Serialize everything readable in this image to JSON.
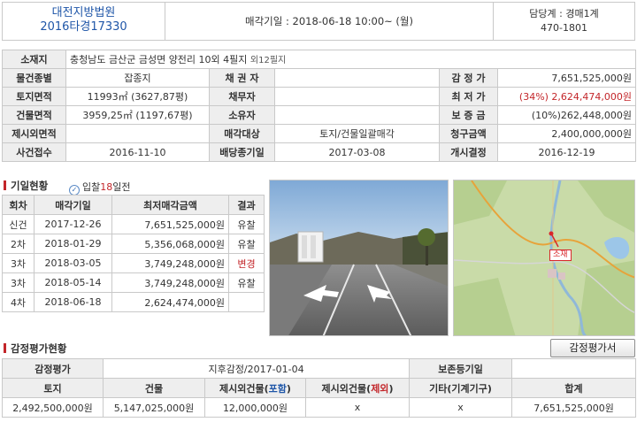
{
  "header": {
    "court": "대전지방법원",
    "case_no": "2016타경17330",
    "sale_date": "매각기일 : 2018-06-18   10:00~ (월)",
    "dept_label": "담당계 : 경매1계",
    "dept_phone": "470-1801"
  },
  "info": {
    "location_label": "소재지",
    "location_value": "충청남도 금산군 금성면 양전리 10외 4필지",
    "location_extra": "외12필지",
    "type_label": "물건종별",
    "type_value": "잡종지",
    "creditor_label": "채 권 자",
    "creditor_value": "",
    "appraisal_label": "감 정 가",
    "appraisal_value": "7,651,525,000원",
    "land_area_label": "토지면적",
    "land_area_value": "11993㎡ (3627,87평)",
    "debtor_label": "채무자",
    "debtor_value": "",
    "min_price_label": "최 저 가",
    "min_price_value": "(34%) 2,624,474,000원",
    "building_area_label": "건물면적",
    "building_area_value": "3959,25㎡ (1197,67평)",
    "owner_label": "소유자",
    "owner_value": "",
    "deposit_label": "보 증 금",
    "deposit_value": "(10%)262,448,000원",
    "excluded_area_label": "제시외면적",
    "excluded_area_value": "",
    "sale_target_label": "매각대상",
    "sale_target_value": "토지/건물일괄매각",
    "claim_label": "청구금액",
    "claim_value": "2,400,000,000원",
    "received_label": "사건접수",
    "received_value": "2016-11-10",
    "dividend_label": "배당종기일",
    "dividend_value": "2017-03-08",
    "start_label": "개시결정",
    "start_value": "2016-12-19"
  },
  "history": {
    "title": "기일현황",
    "notice_prefix": "입찰",
    "notice_days": "18",
    "notice_suffix": "일전",
    "headers": [
      "회차",
      "매각기일",
      "최저매각금액",
      "결과"
    ],
    "rows": [
      {
        "round": "신건",
        "date": "2017-12-26",
        "price": "7,651,525,000원",
        "result": "유찰",
        "highlight": false
      },
      {
        "round": "2차",
        "date": "2018-01-29",
        "price": "5,356,068,000원",
        "result": "유찰",
        "highlight": false
      },
      {
        "round": "3차",
        "date": "2018-03-05",
        "price": "3,749,248,000원",
        "result": "변경",
        "highlight": true
      },
      {
        "round": "3차",
        "date": "2018-05-14",
        "price": "3,749,248,000원",
        "result": "유찰",
        "highlight": false
      },
      {
        "round": "4차",
        "date": "2018-06-18",
        "price": "2,624,474,000원",
        "result": "",
        "highlight": false
      }
    ]
  },
  "map": {
    "marker_label": "소재"
  },
  "appraisal": {
    "title": "감정평가현황",
    "button_label": "감정평가서",
    "label": "감정평가",
    "basis": "지후감정/2017-01-04",
    "registry_label": "보존등기일",
    "registry_value": "",
    "headers": {
      "land": "토지",
      "building": "건물",
      "incl_prefix": "제시외건물(",
      "incl_word": "포함",
      "excl_prefix": "제시외건물(",
      "excl_word": "제외",
      "close_paren": ")",
      "other": "기타(기계기구)",
      "total": "합계"
    },
    "values": {
      "land": "2,492,500,000원",
      "building": "5,147,025,000원",
      "incl": "12,000,000원",
      "excl": "x",
      "other": "x",
      "total": "7,651,525,000원"
    }
  }
}
